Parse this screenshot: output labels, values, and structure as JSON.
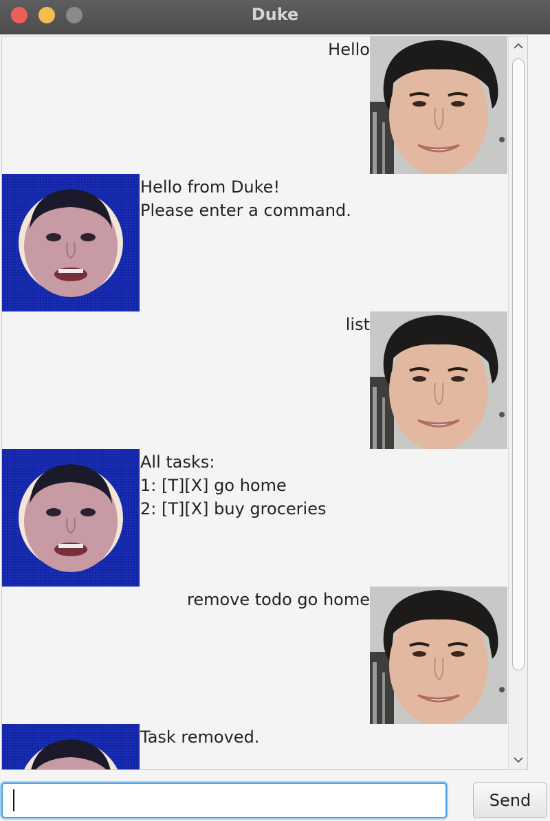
{
  "window": {
    "title": "Duke"
  },
  "dialogs": [
    {
      "speaker": "user",
      "text": "Hello"
    },
    {
      "speaker": "duke",
      "text": "Hello from Duke!\nPlease enter a command."
    },
    {
      "speaker": "user",
      "text": "list"
    },
    {
      "speaker": "duke",
      "text": "All tasks:\n1: [T][X] go home\n2: [T][X] buy groceries"
    },
    {
      "speaker": "user",
      "text": "remove todo go home"
    },
    {
      "speaker": "duke",
      "text": "Task removed."
    }
  ],
  "input": {
    "value": "",
    "placeholder": ""
  },
  "send_button": {
    "label": "Send"
  },
  "colors": {
    "title_bar": "#555555",
    "close": "#ee5f57",
    "minimize": "#f4bd4f",
    "maximize": "#8a8a8a",
    "duke_avatar_bg": "#1326a8",
    "input_focus": "#4aa3e8"
  }
}
